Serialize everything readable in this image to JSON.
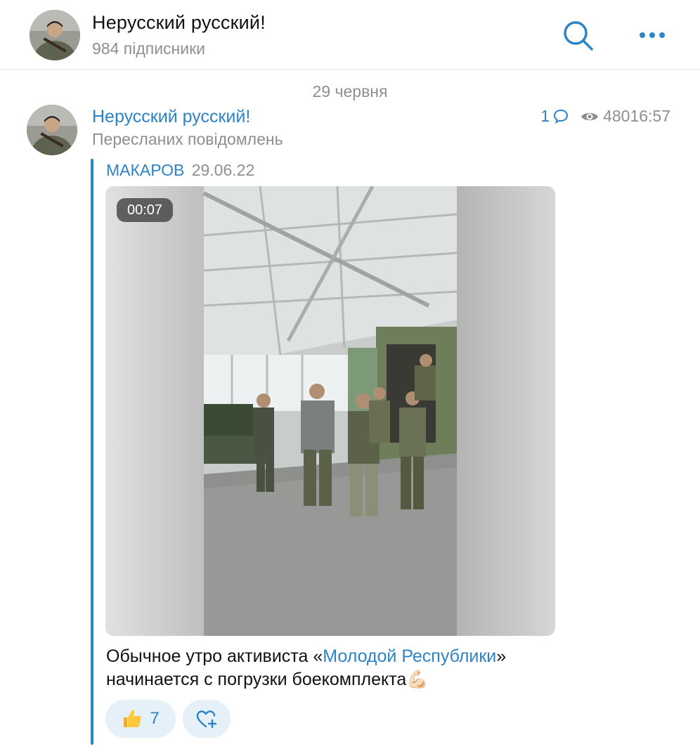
{
  "channel": {
    "name": "Нерусский русский!",
    "subscribers": "984 підписники"
  },
  "icons": {
    "search": "search-icon",
    "more": "more-icon",
    "comment": "comment-bubble-icon",
    "views": "eye-icon",
    "like": "thumbs-up-icon",
    "add_reaction": "add-reaction-heart-icon",
    "flexed_biceps": "flexed-biceps-emoji"
  },
  "date_separator": "29 червня",
  "post": {
    "author": "Нерусский русский!",
    "subtitle": "Пересланих повідомлень",
    "comments": "1",
    "views": "480",
    "time": "16:57",
    "forward": {
      "name": "МАКАРОВ",
      "date": "29.06.22"
    },
    "video": {
      "duration": "00:07"
    },
    "caption": {
      "before": "Обычное утро активиста «",
      "link": "Молодой Республики",
      "after_link": "»",
      "line2": "начинается с погрузки боекомплекта",
      "emoji": "💪🏻"
    },
    "reactions": [
      {
        "emoji": "👍",
        "count": "7"
      }
    ]
  },
  "colors": {
    "accent": "#2d83c5",
    "secondary_text": "#8e8e93",
    "reaction_bg": "#e6f0f9"
  }
}
